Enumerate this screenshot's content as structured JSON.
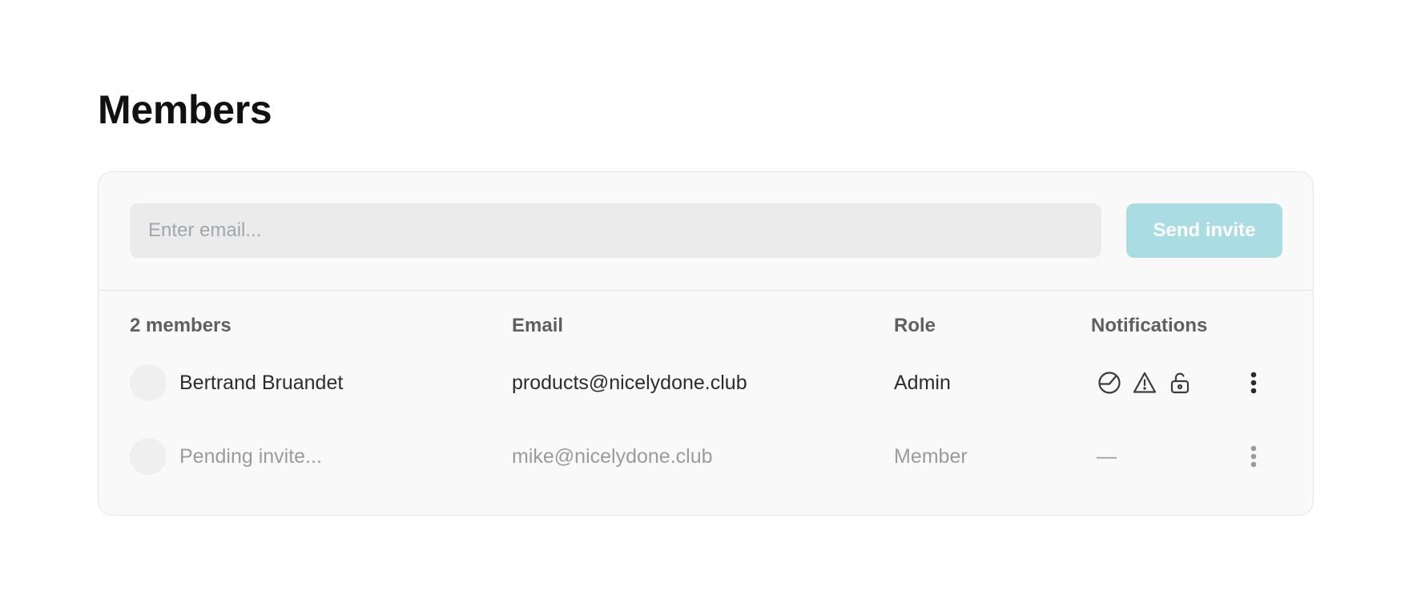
{
  "page": {
    "title": "Members"
  },
  "invite": {
    "placeholder": "Enter email...",
    "value": "",
    "button_label": "Send invite"
  },
  "table": {
    "headers": {
      "count": "2 members",
      "email": "Email",
      "role": "Role",
      "notifications": "Notifications"
    },
    "rows": [
      {
        "name": "Bertrand Bruandet",
        "email": "products@nicelydone.club",
        "role": "Admin",
        "notifications": [
          "chart-icon",
          "warning-icon",
          "unlock-icon"
        ]
      },
      {
        "name": "Pending invite...",
        "email": "mike@nicelydone.club",
        "role": "Member",
        "notifications_placeholder": "—"
      }
    ]
  },
  "colors": {
    "accent_button": "#a9dce3",
    "card_background": "#f9f9f9",
    "input_background": "#ebebeb",
    "muted_text": "#9b9b9b"
  }
}
